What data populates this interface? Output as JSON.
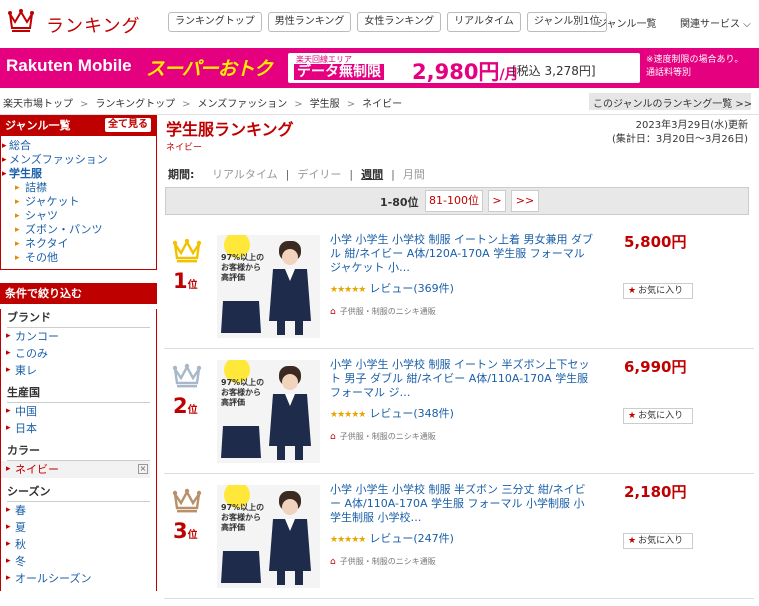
{
  "header": {
    "logo_text": "ランキング",
    "nav": [
      "ランキングトップ",
      "男性ランキング",
      "女性ランキング",
      "リアルタイム",
      "ジャンル別1位"
    ],
    "genre_list": "ジャンル一覧",
    "related": "関連サービス ⌵"
  },
  "banner": {
    "brand": "Rakuten Mobile",
    "super": "スーパーおトク",
    "plan_small": "楽天回線エリア",
    "plan_main": "データ無制限",
    "price": "2,980円",
    "per_month": "/月",
    "tax": "[税込 3,278円]",
    "note_line1": "※速度制限の場合あり。",
    "note_line2": "通話料等別"
  },
  "breadcrumb": {
    "items": [
      "楽天市場トップ",
      "ランキングトップ",
      "メンズファッション",
      "学生服",
      "ネイビー"
    ],
    "sep": ">",
    "right_link": "このジャンルのランキング一覧 >>"
  },
  "sidebar": {
    "genre_title": "ジャンル一覧",
    "see_all": "全て見る",
    "genres": [
      {
        "label": "総合",
        "level": 0,
        "bold": false
      },
      {
        "label": "メンズファッション",
        "level": 0,
        "bold": false
      },
      {
        "label": "学生服",
        "level": 0,
        "bold": true
      },
      {
        "label": "詰襟",
        "level": 1,
        "bold": false
      },
      {
        "label": "ジャケット",
        "level": 1,
        "bold": false
      },
      {
        "label": "シャツ",
        "level": 1,
        "bold": false
      },
      {
        "label": "ズボン・パンツ",
        "level": 1,
        "bold": false
      },
      {
        "label": "ネクタイ",
        "level": 1,
        "bold": false
      },
      {
        "label": "その他",
        "level": 1,
        "bold": false
      }
    ],
    "filter_title": "条件で絞り込む",
    "filters": [
      {
        "title": "ブランド",
        "items": [
          {
            "label": "カンコー"
          },
          {
            "label": "このみ"
          },
          {
            "label": "東レ"
          }
        ]
      },
      {
        "title": "生産国",
        "items": [
          {
            "label": "中国"
          },
          {
            "label": "日本"
          }
        ]
      },
      {
        "title": "カラー",
        "items": [
          {
            "label": "ネイビー",
            "selected": true,
            "x": "×"
          }
        ]
      },
      {
        "title": "シーズン",
        "items": [
          {
            "label": "春"
          },
          {
            "label": "夏"
          },
          {
            "label": "秋"
          },
          {
            "label": "冬"
          },
          {
            "label": "オールシーズン"
          }
        ]
      }
    ]
  },
  "main": {
    "title": "学生服ランキング",
    "subtitle": "ネイビー",
    "updated_line1": "2023年3月29日(水)更新",
    "updated_line2": "(集計日：3月20日〜3月26日)",
    "period_label": "期間:",
    "periods": [
      "リアルタイム",
      "デイリー",
      "週間",
      "月間"
    ],
    "period_selected": "週間",
    "pager": {
      "current": "1-80位",
      "next_range": "81-100位",
      "next": ">",
      "last": ">>"
    },
    "items": [
      {
        "rank": "1",
        "rank_suffix": "位",
        "crown": "gold",
        "crown_color": "#f2c200",
        "name": "小学 小学生 小学校 制服 イートン上着 男女兼用 ダブル 紺/ネイビー A体/120A-170A 学生服 フォーマル ジャケット 小…",
        "price": "5,800円",
        "stars": "★★★★★",
        "review": "レビュー(369件)",
        "shop": "子供服・制服のニシキ通販",
        "fav": "お気に入り",
        "thumb_badge": "97%以上のお客様から高評価"
      },
      {
        "rank": "2",
        "rank_suffix": "位",
        "crown": "silver",
        "crown_color": "#a8b8c8",
        "name": "小学 小学生 小学校 制服 イートン 半ズボン上下セット 男子 ダブル 紺/ネイビー A体/110A-170A 学生服 フォーマル ジ…",
        "price": "6,990円",
        "stars": "★★★★★",
        "review": "レビュー(348件)",
        "shop": "子供服・制服のニシキ通販",
        "fav": "お気に入り",
        "thumb_badge": "97%以上のお客様から高評価"
      },
      {
        "rank": "3",
        "rank_suffix": "位",
        "crown": "bronze",
        "crown_color": "#b8906a",
        "name": "小学 小学生 小学校 制服 半ズボン 三分丈 紺/ネイビー A体/110A-170A 学生服 フォーマル 小学制服 小学生制服 小学校…",
        "price": "2,180円",
        "stars": "★★★★★",
        "review": "レビュー(247件)",
        "shop": "子供服・制服のニシキ通販",
        "fav": "お気に入り",
        "thumb_badge": "97%以上のお客様から高評価"
      }
    ]
  },
  "colors": {
    "accent": "#bf0000",
    "banner": "#e4007f",
    "link": "#1a5fa8"
  }
}
